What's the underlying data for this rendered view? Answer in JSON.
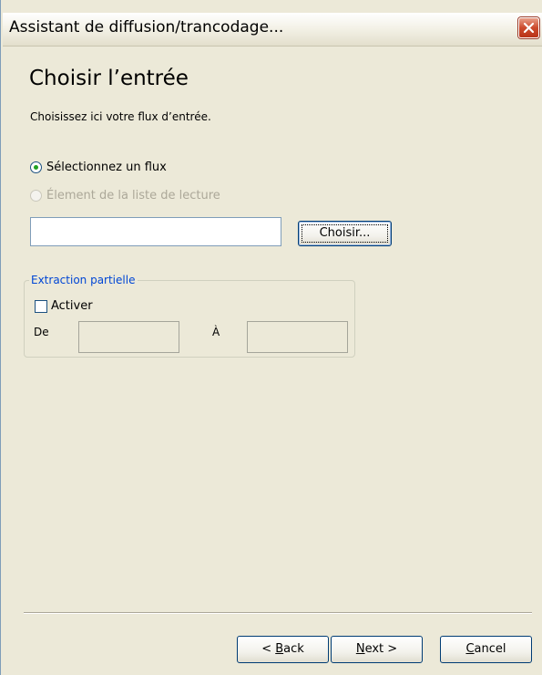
{
  "window": {
    "title": "Assistant de diffusion/trancodage..."
  },
  "page": {
    "heading": "Choisir l’entrée",
    "description": "Choisissez ici votre flux d’entrée."
  },
  "source": {
    "option_stream": {
      "label": "Sélectionnez un flux",
      "selected": true,
      "enabled": true
    },
    "option_playlist": {
      "label": "Élement de la liste de lecture",
      "selected": false,
      "enabled": false
    },
    "stream_value": "",
    "choose_button": "Choisir..."
  },
  "partial_extraction": {
    "legend": "Extraction partielle",
    "enable_label": "Activer",
    "enable_checked": false,
    "from_label": "De",
    "to_label": "À",
    "from_value": "",
    "to_value": ""
  },
  "buttons": {
    "back": {
      "prefix": "< ",
      "mnemonic": "B",
      "rest": "ack"
    },
    "next": {
      "mnemonic": "N",
      "rest": "ext >"
    },
    "cancel": {
      "mnemonic": "C",
      "rest": "ancel"
    }
  },
  "icons": {
    "close": "close-icon",
    "radio": "radio-button",
    "checkbox": "checkbox"
  },
  "colors": {
    "window_bg": "#ece9d8",
    "legend_text": "#0046d5",
    "radio_dot": "#21a121",
    "close_button": "#cc4a2d"
  }
}
